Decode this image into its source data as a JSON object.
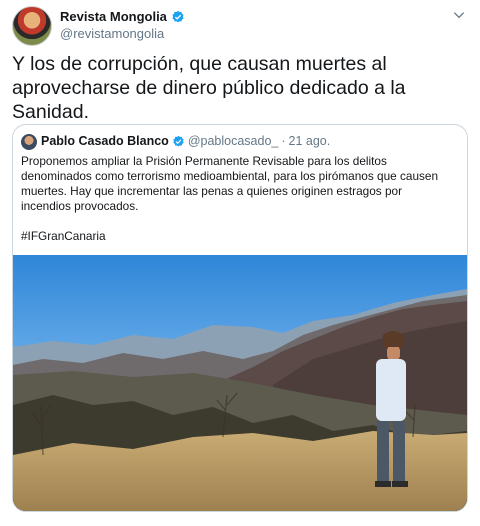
{
  "tweet": {
    "display_name": "Revista Mongolia",
    "handle": "@revistamongolia",
    "text": "Y los de corrupción, que causan muertes al aprovecharse de dinero público dedicado a la Sanidad."
  },
  "quoted": {
    "display_name": "Pablo Casado Blanco",
    "handle": "@pablocasado_",
    "separator": "·",
    "date": "21 ago.",
    "text": "Proponemos ampliar la Prisión Permanente Revisable para los delitos denominados como terrorismo medioambiental, para los pirómanos que causen muertes. Hay que incrementar las penas a quienes originen estragos por incendios provocados.",
    "hashtag": "#IFGranCanaria"
  },
  "colors": {
    "verified": "#1da1f2",
    "secondary_text": "#657786",
    "border": "#ccd6dd"
  },
  "icons": [
    "verified-badge-icon",
    "chevron-down-icon"
  ]
}
